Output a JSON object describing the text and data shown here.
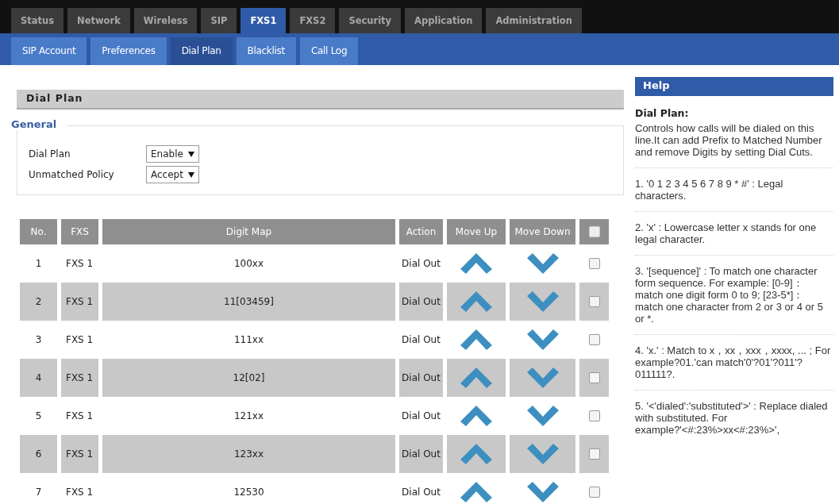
{
  "main_tabs": [
    {
      "label": "Status",
      "selected": false
    },
    {
      "label": "Network",
      "selected": false
    },
    {
      "label": "Wireless",
      "selected": false
    },
    {
      "label": "SIP",
      "selected": false
    },
    {
      "label": "FXS1",
      "selected": true
    },
    {
      "label": "FXS2",
      "selected": false
    },
    {
      "label": "Security",
      "selected": false
    },
    {
      "label": "Application",
      "selected": false
    },
    {
      "label": "Administration",
      "selected": false
    }
  ],
  "sub_tabs": [
    {
      "label": "SIP Account",
      "selected": false
    },
    {
      "label": "Preferences",
      "selected": false
    },
    {
      "label": "Dial Plan",
      "selected": true
    },
    {
      "label": "Blacklist",
      "selected": false
    },
    {
      "label": "Call Log",
      "selected": false
    }
  ],
  "section_title": "Dial Plan",
  "general": {
    "legend": "General",
    "fields": [
      {
        "label": "Dial Plan",
        "value": "Enable"
      },
      {
        "label": "Unmatched Policy",
        "value": "Accept"
      }
    ]
  },
  "table": {
    "columns": [
      "No.",
      "FXS",
      "Digit Map",
      "Action",
      "Move Up",
      "Move Down"
    ],
    "header_checkbox": {
      "checked": false
    },
    "rows": [
      {
        "no": "1",
        "fxs": "FXS 1",
        "digit_map": "100xx",
        "action": "Dial Out",
        "checked": false
      },
      {
        "no": "2",
        "fxs": "FXS 1",
        "digit_map": "11[03459]",
        "action": "Dial Out",
        "checked": false
      },
      {
        "no": "3",
        "fxs": "FXS 1",
        "digit_map": "111xx",
        "action": "Dial Out",
        "checked": false
      },
      {
        "no": "4",
        "fxs": "FXS 1",
        "digit_map": "12[02]",
        "action": "Dial Out",
        "checked": false
      },
      {
        "no": "5",
        "fxs": "FXS 1",
        "digit_map": "121xx",
        "action": "Dial Out",
        "checked": false
      },
      {
        "no": "6",
        "fxs": "FXS 1",
        "digit_map": "123xx",
        "action": "Dial Out",
        "checked": false
      },
      {
        "no": "7",
        "fxs": "FXS 1",
        "digit_map": "12530",
        "action": "Dial Out",
        "checked": false
      }
    ]
  },
  "help": {
    "title": "Help",
    "subtitle": "Dial Plan:",
    "paragraphs": [
      "Controls how calls will be dialed on this line.It can add Prefix to Matched Number and remove Digits by setting Dial Cuts.",
      "1. '0 1 2 3 4 5 6 7 8 9 * #' : Legal characters.",
      "2. 'x' : Lowercase letter x stands for one legal character.",
      "3. '[sequence]' : To match one character form sequence. For example: [0-9]： match one digit form 0 to 9; [23-5*]： match one character from 2 or 3 or 4 or 5 or *.",
      "4. 'x.' : Match to x，xx，xxx，xxxx, ... ; For example?01.'can match'0'?01'?011'?011111?.",
      "5. '<'dialed':'substituted'>' : Replace dialed with substituted. For example?'<#:23%>xx<#:23%>',"
    ]
  }
}
